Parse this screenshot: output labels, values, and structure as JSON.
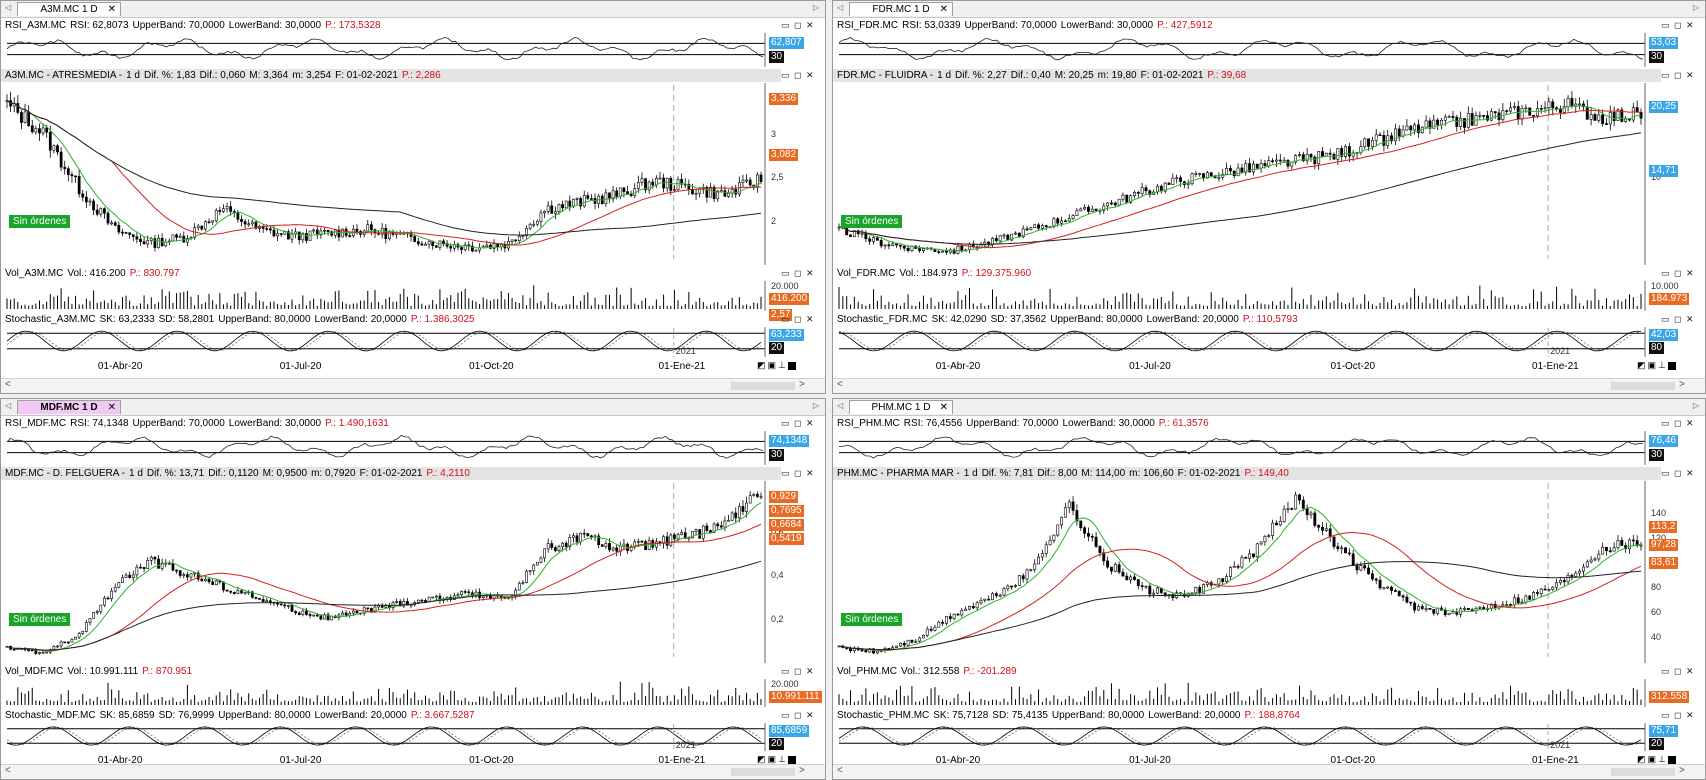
{
  "colors": {
    "price": "#000000",
    "ma_fast": "#2db52d",
    "ma_mid": "#d62020",
    "ma_long": "#222222",
    "badge_blue": "#3aa6e8",
    "badge_orange": "#e96a22",
    "sin": "#1aa52a",
    "tab_active": "#f1c9f4"
  },
  "charts": [
    {
      "tab": "A3M.MC 1 D",
      "active": false,
      "rsi": {
        "name": "RSI_A3M.MC",
        "rsi": "RSI: 62,8073",
        "up": "UpperBand: 70,0000",
        "low": "LowerBand: 30,0000",
        "p": "P.: 173,5328",
        "badge1": "62,807",
        "badge2": "30"
      },
      "price": {
        "name": "A3M.MC - ATRESMEDIA -",
        "tf": "1 d",
        "pct": "Dif. %: 1,83",
        "dif": "Dif.: 0,060",
        "max": "M: 3,364",
        "min": "m: 3,254",
        "date": "F: 01-02-2021",
        "p": "P.: 2,286",
        "ticks": [
          "3",
          "2,5",
          "2"
        ],
        "badges": [
          "3,336",
          "3,082",
          "2,57"
        ]
      },
      "sin": "Sin órdenes",
      "vol": {
        "name": "Vol_A3M.MC",
        "vol": "Vol.: 416.200",
        "p": "P.: 830.797",
        "tick": "20.000",
        "badge": "416.200"
      },
      "stoch": {
        "name": "Stochastic_A3M.MC",
        "sk": "SK: 63,2333",
        "sd": "SD: 58,2801",
        "up": "UpperBand: 80,0000",
        "low": "LowerBand: 20,0000",
        "p": "P.: 1.386,3025",
        "badge1": "63,233",
        "badge2": "20",
        "year": "2021"
      },
      "dates": [
        "01-Abr-20",
        "01-Jul-20",
        "01-Oct-20",
        "01-Ene-21"
      ]
    },
    {
      "tab": "FDR.MC 1 D",
      "active": false,
      "rsi": {
        "name": "RSI_FDR.MC",
        "rsi": "RSI: 53,0339",
        "up": "UpperBand: 70,0000",
        "low": "LowerBand: 30,0000",
        "p": "P.: 427,5912",
        "badge1": "53,03",
        "badge2": "30"
      },
      "price": {
        "name": "FDR.MC - FLUIDRA -",
        "tf": "1 d",
        "pct": "Dif. %: 2,27",
        "dif": "Dif.: 0,40",
        "max": "M: 20,25",
        "min": "m: 19,80",
        "date": "F: 01-02-2021",
        "p": "P.: 39,68",
        "ticks": [
          "10"
        ],
        "badges": [
          "20,25",
          "14,71"
        ]
      },
      "sin": "Sin órdenes",
      "vol": {
        "name": "Vol_FDR.MC",
        "vol": "Vol.: 184.973",
        "p": "P.: 129.375.960",
        "tick": "10.000",
        "badge": "184.973"
      },
      "stoch": {
        "name": "Stochastic_FDR.MC",
        "sk": "SK: 42,0290",
        "sd": "SD: 37,3562",
        "up": "UpperBand: 80,0000",
        "low": "LowerBand: 20,0000",
        "p": "P.: 110,5793",
        "badge1": "42,03",
        "badge2": "80",
        "year": "2021"
      },
      "dates": [
        "01-Abr-20",
        "01-Jul-20",
        "01-Oct-20",
        "01-Ene-21"
      ]
    },
    {
      "tab": "MDF.MC 1 D",
      "active": true,
      "rsi": {
        "name": "RSI_MDF.MC",
        "rsi": "RSI: 74,1348",
        "up": "UpperBand: 70,0000",
        "low": "LowerBand: 30,0000",
        "p": "P.: 1.490,1631",
        "badge1": "74,1348",
        "badge2": "30"
      },
      "price": {
        "name": "MDF.MC - D. FELGUERA -",
        "tf": "1 d",
        "pct": "Dif. %: 13,71",
        "dif": "Dif.: 0,1120",
        "max": "M: 0,9500",
        "min": "m: 0,7920",
        "date": "F: 01-02-2021",
        "p": "P.: 4,2110",
        "ticks": [
          "0,6",
          "0,4",
          "0,2"
        ],
        "badges": [
          "0,929",
          "0,7695",
          "0,6684",
          "0,5419"
        ]
      },
      "sin": "Sin órdenes",
      "vol": {
        "name": "Vol_MDF.MC",
        "vol": "Vol.: 10.991.111",
        "p": "P.: 870.951",
        "tick": "20.000",
        "badge": "10.991.111"
      },
      "stoch": {
        "name": "Stochastic_MDF.MC",
        "sk": "SK: 85,6859",
        "sd": "SD: 76,9999",
        "up": "UpperBand: 80,0000",
        "low": "LowerBand: 20,0000",
        "p": "P.: 3.667,5287",
        "badge1": "85,6859",
        "badge2": "20",
        "year": "2021"
      },
      "dates": [
        "01-Abr-20",
        "01-Jul-20",
        "01-Oct-20",
        "01-Ene-21"
      ]
    },
    {
      "tab": "PHM.MC 1 D",
      "active": false,
      "rsi": {
        "name": "RSI_PHM.MC",
        "rsi": "RSI: 76,4556",
        "up": "UpperBand: 70,0000",
        "low": "LowerBand: 30,0000",
        "p": "P.: 61,3576",
        "badge1": "76,46",
        "badge2": "30"
      },
      "price": {
        "name": "PHM.MC - PHARMA MAR -",
        "tf": "1 d",
        "pct": "Dif. %: 7,81",
        "dif": "Dif.: 8,00",
        "max": "M: 114,00",
        "min": "m: 106,60",
        "date": "F: 01-02-2021",
        "p": "P.: 149,40",
        "ticks": [
          "140",
          "120",
          "100",
          "80",
          "60",
          "40"
        ],
        "badges": [
          "113,2",
          "97,28",
          "83,61"
        ]
      },
      "sin": "Sin órdenes",
      "vol": {
        "name": "Vol_PHM.MC",
        "vol": "Vol.: 312.558",
        "p": "P.: -201.289",
        "tick": "",
        "badge": "312.558"
      },
      "stoch": {
        "name": "Stochastic_PHM.MC",
        "sk": "SK: 75,7128",
        "sd": "SD: 75,4135",
        "up": "UpperBand: 80,0000",
        "low": "LowerBand: 20,0000",
        "p": "P.: 188,8764",
        "badge1": "75,71",
        "badge2": "20",
        "year": "2021"
      },
      "dates": [
        "01-Abr-20",
        "01-Jul-20",
        "01-Oct-20",
        "01-Ene-21"
      ]
    }
  ],
  "chart_data": [
    {
      "type": "line",
      "ticker": "A3M.MC",
      "series_shape": [
        4.4,
        4.0,
        3.2,
        2.6,
        2.4,
        2.5,
        2.9,
        2.6,
        2.5,
        2.55,
        2.6,
        2.5,
        2.4,
        2.35,
        2.4,
        2.9,
        3.0,
        3.1,
        3.3,
        3.2,
        3.1,
        3.336
      ]
    },
    {
      "type": "line",
      "ticker": "FDR.MC",
      "series_shape": [
        11,
        10,
        9.5,
        9.3,
        10,
        11,
        12,
        13,
        14,
        15,
        15.5,
        16,
        16.5,
        17,
        18,
        19,
        19.5,
        20,
        20.5,
        21,
        20,
        20.25
      ]
    },
    {
      "type": "line",
      "ticker": "MDF.MC",
      "series_shape": [
        0.3,
        0.28,
        0.35,
        0.55,
        0.65,
        0.6,
        0.55,
        0.5,
        0.45,
        0.42,
        0.45,
        0.48,
        0.5,
        0.52,
        0.5,
        0.7,
        0.75,
        0.7,
        0.72,
        0.75,
        0.8,
        0.929
      ]
    },
    {
      "type": "line",
      "ticker": "PHM.MC",
      "series_shape": [
        50,
        48,
        55,
        70,
        80,
        95,
        135,
        100,
        85,
        80,
        90,
        110,
        140,
        110,
        90,
        75,
        70,
        75,
        80,
        90,
        110,
        113.2
      ]
    }
  ]
}
